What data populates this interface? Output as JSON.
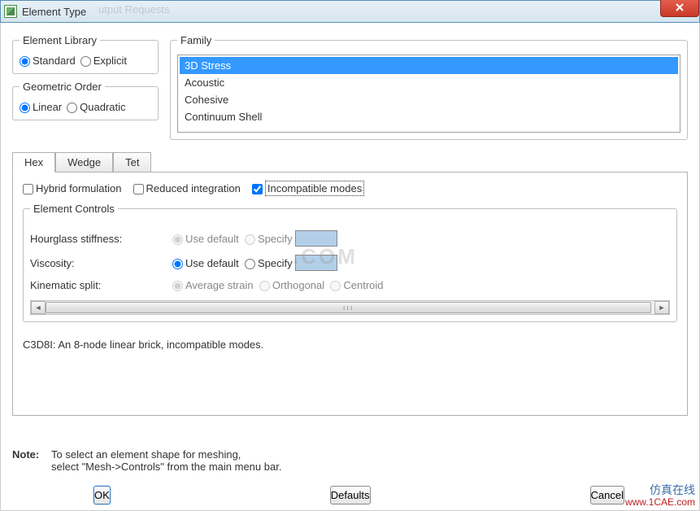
{
  "title": "Element Type",
  "elementLibrary": {
    "legend": "Element Library",
    "options": {
      "standard": "Standard",
      "explicit": "Explicit"
    }
  },
  "geometricOrder": {
    "legend": "Geometric Order",
    "options": {
      "linear": "Linear",
      "quadratic": "Quadratic"
    }
  },
  "family": {
    "legend": "Family",
    "items": [
      "3D Stress",
      "Acoustic",
      "Cohesive",
      "Continuum Shell"
    ]
  },
  "tabs": {
    "hex": "Hex",
    "wedge": "Wedge",
    "tet": "Tet"
  },
  "checkboxes": {
    "hybrid": "Hybrid formulation",
    "reduced": "Reduced integration",
    "incompat": "Incompatible modes"
  },
  "controls": {
    "legend": "Element Controls",
    "hourglass": "Hourglass stiffness:",
    "viscosity": "Viscosity:",
    "kinematic": "Kinematic split:",
    "opts": {
      "useDefault": "Use default",
      "specify": "Specify",
      "avgStrain": "Average strain",
      "orthogonal": "Orthogonal",
      "centroid": "Centroid"
    }
  },
  "description": "C3D8I:  An 8-node linear brick, incompatible modes.",
  "note": {
    "label": "Note:",
    "line1": "To select an element shape for meshing,",
    "line2": "select \"Mesh->Controls\" from the main menu bar."
  },
  "buttons": {
    "ok": "OK",
    "defaults": "Defaults",
    "cancel": "Cancel"
  },
  "watermark": {
    "cn": "仿真在线",
    "url": "www.1CAE.com",
    "center": ".COM"
  },
  "ghost": "utput Requests"
}
